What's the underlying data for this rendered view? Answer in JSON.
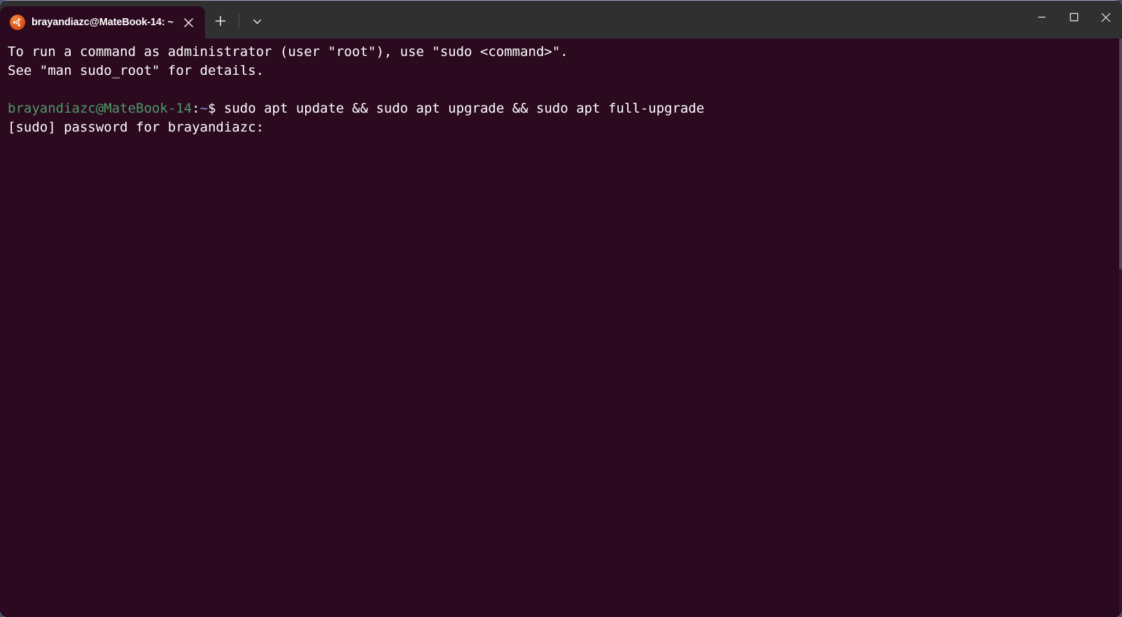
{
  "window": {
    "tab": {
      "icon": "ubuntu-logo-icon",
      "title": "brayandiazc@MateBook-14: ~",
      "close_label": "×"
    },
    "actions": {
      "new_tab_label": "+",
      "tab_menu_label": "⌄"
    },
    "controls": {
      "minimize_label": "–",
      "maximize_label": "□",
      "close_label": "✕"
    }
  },
  "terminal": {
    "colors": {
      "background": "#2b0a1f",
      "foreground": "#ffffff",
      "prompt_user_host": "#4e9a69",
      "prompt_path": "#8e8ee0",
      "titlebar": "#303030"
    },
    "lines": [
      {
        "segments": [
          {
            "text": "To run a command as administrator (user \"root\"), use \"sudo <command>\".",
            "color": "white"
          }
        ]
      },
      {
        "segments": [
          {
            "text": "See \"man sudo_root\" for details.",
            "color": "white"
          }
        ]
      },
      {
        "segments": [
          {
            "text": "",
            "color": "white"
          }
        ]
      },
      {
        "segments": [
          {
            "text": "brayandiazc@MateBook-14",
            "color": "green"
          },
          {
            "text": ":",
            "color": "white"
          },
          {
            "text": "~",
            "color": "blue"
          },
          {
            "text": "$ sudo apt update && sudo apt upgrade && sudo apt full-upgrade",
            "color": "white"
          }
        ]
      },
      {
        "segments": [
          {
            "text": "[sudo] password for brayandiazc:",
            "color": "white"
          }
        ]
      }
    ]
  }
}
